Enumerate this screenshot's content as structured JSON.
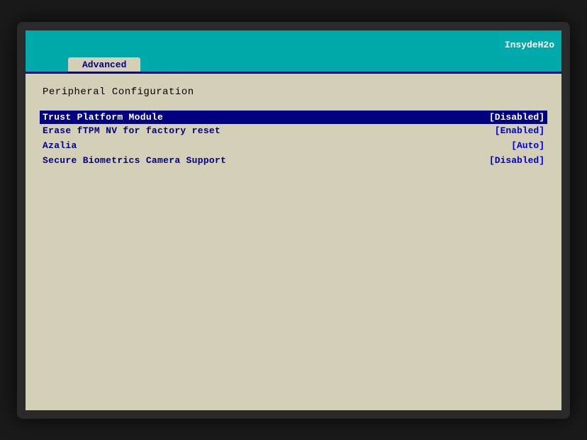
{
  "bios": {
    "brand": "InsydeH2o",
    "tab_label": "Advanced",
    "section_title": "Peripheral Configuration",
    "menu_items": [
      {
        "label": "Trust Platform Module",
        "value": "[Disabled]",
        "selected": true
      },
      {
        "label": "Erase fTPM NV for factory reset",
        "value": "[Enabled]",
        "selected": false
      },
      {
        "label": "Azalia",
        "value": "[Auto]",
        "selected": false
      },
      {
        "label": "Secure Biometrics Camera Support",
        "value": "[Disabled]",
        "selected": false
      }
    ],
    "colors": {
      "bg": "#d4d0b8",
      "header_bg": "#00aaaa",
      "tab_text": "#000080",
      "menu_text": "#000080",
      "selected_bg": "#000080",
      "separator": "#0000aa"
    }
  }
}
